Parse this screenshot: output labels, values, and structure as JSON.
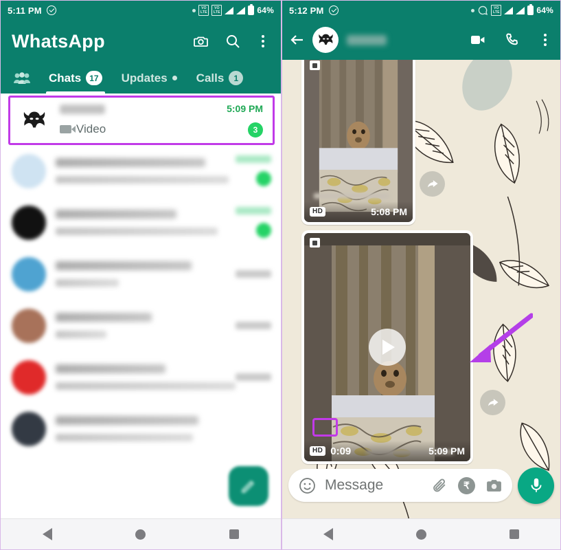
{
  "left_phone": {
    "status_bar": {
      "time": "5:11 PM",
      "battery_percent": "64%",
      "icons": [
        "check-circle-icon",
        "dot-icon",
        "volte-icon",
        "volte-icon",
        "signal-icon",
        "signal-icon",
        "battery-icon"
      ]
    },
    "app_bar": {
      "title": "WhatsApp",
      "actions": [
        "camera-icon",
        "search-icon",
        "overflow-menu-icon"
      ]
    },
    "tabs": [
      {
        "label": "",
        "icon": "communities-icon",
        "badge": "",
        "active": false
      },
      {
        "label": "Chats",
        "icon": "",
        "badge": "17",
        "active": true
      },
      {
        "label": "Updates",
        "icon": "",
        "badge": "•",
        "active": false
      },
      {
        "label": "Calls",
        "icon": "",
        "badge": "1",
        "active": false
      }
    ],
    "highlighted_chat": {
      "avatar": "batman-avatar",
      "name": "",
      "preview": "Video",
      "preview_icon": "video-camera-icon",
      "time": "5:09 PM",
      "unread_count": "3",
      "highlight_color": "#c13ae8"
    },
    "other_chats": [
      {
        "avatar_color": "#cfe3f2",
        "time_color": "#a9e8c4",
        "has_unread": true
      },
      {
        "avatar_color": "#111111",
        "time_color": "#a9e8c4",
        "has_unread": true
      },
      {
        "avatar_color": "#4fa3d1",
        "time_color": "#c9c9c9",
        "has_unread": false
      },
      {
        "avatar_color": "#a8725a",
        "time_color": "#c9c9c9",
        "has_unread": false
      },
      {
        "avatar_color": "#e02a2a",
        "time_color": "#c9c9c9",
        "has_unread": false
      },
      {
        "avatar_color": "#333a44",
        "time_color": "#c9c9c9",
        "has_unread": false
      }
    ],
    "fab": "new-chat-fab",
    "nav_bar": [
      "back-icon",
      "home-icon",
      "recents-icon"
    ]
  },
  "right_phone": {
    "status_bar": {
      "time": "5:12 PM",
      "battery_percent": "64%",
      "icons": [
        "check-circle-icon",
        "dot-icon",
        "whatsapp-status-icon",
        "volte-icon",
        "signal-icon",
        "signal-icon",
        "battery-icon"
      ]
    },
    "chat_header": {
      "back": "back-arrow-icon",
      "avatar": "batman-avatar",
      "contact_name": "",
      "actions": [
        "video-call-icon",
        "voice-call-icon",
        "overflow-menu-icon"
      ]
    },
    "messages": [
      {
        "id": "message-1",
        "type": "video",
        "hd_badge": "HD",
        "duration": "",
        "time": "5:08 PM",
        "has_play_button": false,
        "has_forward_button": true
      },
      {
        "id": "message-2",
        "type": "video",
        "hd_badge": "HD",
        "duration": "0:09",
        "time": "5:09 PM",
        "has_play_button": true,
        "has_forward_button": true,
        "hd_highlighted": true,
        "annotation": "arrow-pointing-to-video"
      }
    ],
    "input_bar": {
      "emoji_icon": "emoji-icon",
      "placeholder": "Message",
      "attach_icon": "paperclip-icon",
      "payment_icon": "rupee-icon",
      "camera_icon": "camera-icon",
      "mic_button": "microphone-fab"
    },
    "nav_bar": [
      "back-icon",
      "home-icon",
      "recents-icon"
    ]
  },
  "colors": {
    "whatsapp_teal": "#0b7f6c",
    "whatsapp_green": "#25d366",
    "highlight_purple": "#c13ae8",
    "chat_bg": "#efe9da"
  }
}
